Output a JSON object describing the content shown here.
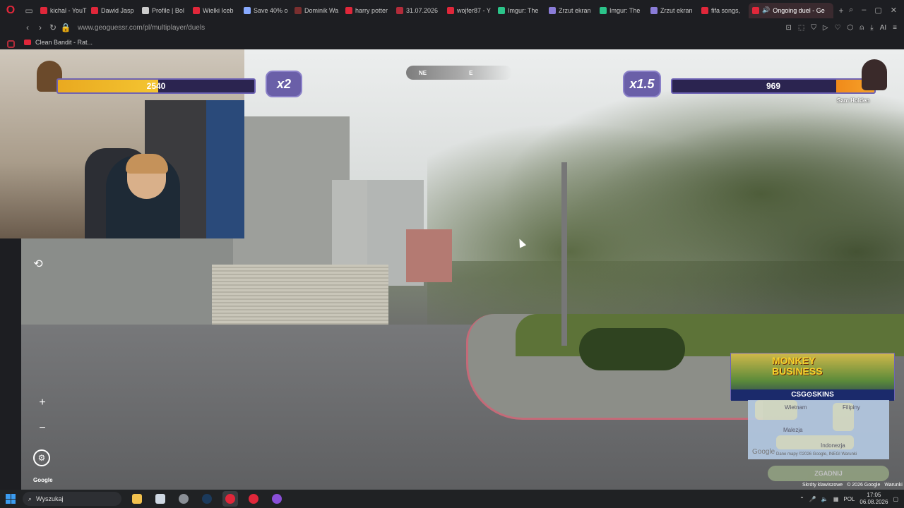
{
  "browser": {
    "tabs": [
      {
        "label": "kichal - YouT",
        "color": "#e0273a"
      },
      {
        "label": "Dawid Jasp",
        "color": "#e0273a"
      },
      {
        "label": "Profile | Bol",
        "color": "#cccccc"
      },
      {
        "label": "Wielki Iceb",
        "color": "#e0273a"
      },
      {
        "label": "Save 40% o",
        "color": "#88aaff"
      },
      {
        "label": "Dominik Wa",
        "color": "#7a2f2f"
      },
      {
        "label": "harry potter",
        "color": "#e0273a"
      },
      {
        "label": "31.07.2026",
        "color": "#b32c3a"
      },
      {
        "label": "wojfer87 - Y",
        "color": "#e0273a"
      },
      {
        "label": "Imgur: The",
        "color": "#2bc48a"
      },
      {
        "label": "Zrzut ekran",
        "color": "#8a7cd8"
      },
      {
        "label": "Imgur: The",
        "color": "#2bc48a"
      },
      {
        "label": "Zrzut ekran",
        "color": "#8a7cd8"
      },
      {
        "label": "fifa songs,",
        "color": "#e0273a"
      }
    ],
    "active_tab": "Ongoing duel - Ge",
    "url": "www.geoguessr.com/pl/multiplayer/duels",
    "bookmark": "Clean Bandit - Rat..."
  },
  "game": {
    "left_player": {
      "score": "2540",
      "multiplier": "x2",
      "health_fraction": 0.51
    },
    "right_player": {
      "score": "969",
      "multiplier": "x1.5",
      "name": "Sam Holden",
      "health_fraction": 0.19
    },
    "compass": {
      "left": "NE",
      "right": "E"
    },
    "google_label": "Google"
  },
  "ad": {
    "title_line1": "MONKEY",
    "title_line2": "BUSINESS",
    "footer": "CSG⊙SKINS"
  },
  "minimap": {
    "labels": [
      "Wietnam",
      "Filipiny",
      "Malezja",
      "Indonezja"
    ],
    "google": "Google",
    "footer": "Dane mapy ©2026 Google, INEGI   Warunki"
  },
  "guess_button": "ZGADNIJ",
  "page_footer": [
    "Skróty klawiszowe",
    "© 2026 Google",
    "Warunki"
  ],
  "taskbar": {
    "search_placeholder": "Wyszukaj",
    "lang": "POL",
    "time": "17:05",
    "date": "06.08.2026"
  }
}
